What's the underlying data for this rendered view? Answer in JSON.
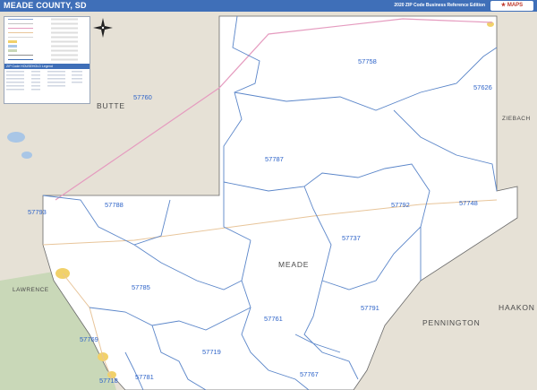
{
  "header": {
    "title": "MEADE COUNTY, SD",
    "edition": "2020 ZIP Code Business Reference Edition"
  },
  "legend": {
    "rows": [
      "",
      "",
      "",
      "",
      "",
      "",
      "",
      "",
      "",
      "",
      "",
      ""
    ],
    "table_header": "ZIP Code HOUSEHOLD Legend"
  },
  "counties": {
    "butte": "BUTTE",
    "ziebach": "ZIEBACH",
    "meade": "MEADE",
    "pennington": "PENNINGTON",
    "haakon": "HAAKON",
    "lawrence": "LAWRENCE"
  },
  "zip_labels": {
    "z57758": "57758",
    "z57626": "57626",
    "z57760": "57760",
    "z57787": "57787",
    "z57792": "57792",
    "z57748": "57748",
    "z57793": "57793",
    "z57788": "57788",
    "z57737": "57737",
    "z57785": "57785",
    "z57791": "57791",
    "z57761": "57761",
    "z57769": "57769",
    "z57719": "57719",
    "z57781": "57781",
    "z57718": "57718",
    "z57767": "57767"
  },
  "colors": {
    "background_outside": "#e6e1d6",
    "county_fill": "#ffffff",
    "zip_boundary": "#5b86c9",
    "highway": "#e59bbf",
    "state_road": "#e8c59a",
    "forest_green": "#c9d8b8",
    "header_blue": "#3f6fb8"
  },
  "icons": {
    "compass": "north-arrow-icon",
    "logo": "market-maps-logo"
  }
}
